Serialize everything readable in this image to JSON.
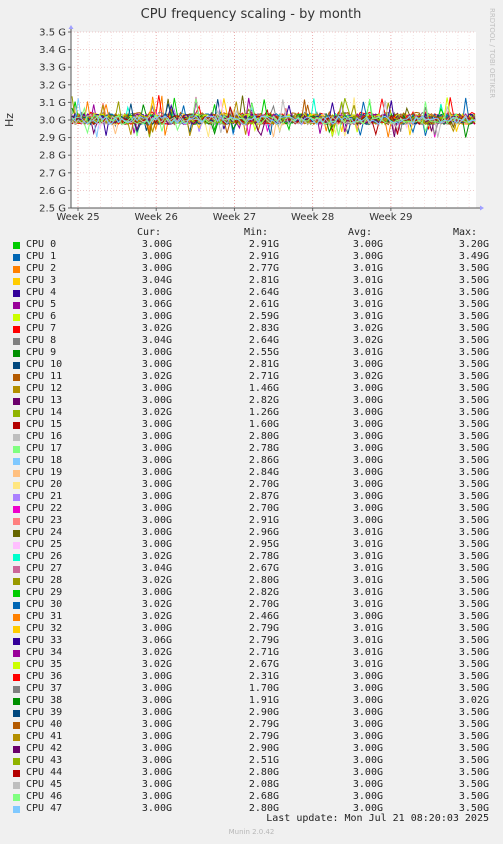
{
  "watermark": "RRDTOOL / TOBI OETIKER",
  "footer": {
    "last_update": "Last update: Mon Jul 21 08:20:03 2025",
    "version": "Munin 2.0.42"
  },
  "legend_headers": {
    "cur": "Cur:",
    "min": "Min:",
    "avg": "Avg:",
    "max": "Max:"
  },
  "chart_data": {
    "type": "line",
    "title": "CPU frequency scaling - by month",
    "ylabel": "Hz",
    "ylim": [
      2.5,
      3.5
    ],
    "yticks": [
      "2.5 G",
      "2.6 G",
      "2.7 G",
      "2.8 G",
      "2.9 G",
      "3.0 G",
      "3.1 G",
      "3.2 G",
      "3.3 G",
      "3.4 G",
      "3.5 G"
    ],
    "xticks": [
      "Week 25",
      "Week 26",
      "Week 27",
      "Week 28",
      "Week 29"
    ],
    "grid": true,
    "series": [
      {
        "name": "CPU 0",
        "color": "#00cc00",
        "cur": "3.00G",
        "min": "2.91G",
        "avg": "3.00G",
        "max": "3.20G"
      },
      {
        "name": "CPU 1",
        "color": "#0066b3",
        "cur": "3.00G",
        "min": "2.91G",
        "avg": "3.00G",
        "max": "3.49G"
      },
      {
        "name": "CPU 2",
        "color": "#ff8000",
        "cur": "3.00G",
        "min": "2.77G",
        "avg": "3.01G",
        "max": "3.50G"
      },
      {
        "name": "CPU 3",
        "color": "#ffcc00",
        "cur": "3.04G",
        "min": "2.81G",
        "avg": "3.01G",
        "max": "3.50G"
      },
      {
        "name": "CPU 4",
        "color": "#330099",
        "cur": "3.00G",
        "min": "2.64G",
        "avg": "3.01G",
        "max": "3.50G"
      },
      {
        "name": "CPU 5",
        "color": "#990099",
        "cur": "3.06G",
        "min": "2.61G",
        "avg": "3.01G",
        "max": "3.50G"
      },
      {
        "name": "CPU 6",
        "color": "#ccff00",
        "cur": "3.00G",
        "min": "2.59G",
        "avg": "3.01G",
        "max": "3.50G"
      },
      {
        "name": "CPU 7",
        "color": "#ff0000",
        "cur": "3.02G",
        "min": "2.83G",
        "avg": "3.02G",
        "max": "3.50G"
      },
      {
        "name": "CPU 8",
        "color": "#808080",
        "cur": "3.04G",
        "min": "2.64G",
        "avg": "3.02G",
        "max": "3.50G"
      },
      {
        "name": "CPU 9",
        "color": "#008f00",
        "cur": "3.00G",
        "min": "2.55G",
        "avg": "3.01G",
        "max": "3.50G"
      },
      {
        "name": "CPU 10",
        "color": "#00487d",
        "cur": "3.00G",
        "min": "2.81G",
        "avg": "3.00G",
        "max": "3.50G"
      },
      {
        "name": "CPU 11",
        "color": "#b35a00",
        "cur": "3.02G",
        "min": "2.71G",
        "avg": "3.02G",
        "max": "3.50G"
      },
      {
        "name": "CPU 12",
        "color": "#b38f00",
        "cur": "3.00G",
        "min": "1.46G",
        "avg": "3.00G",
        "max": "3.50G"
      },
      {
        "name": "CPU 13",
        "color": "#6b006b",
        "cur": "3.00G",
        "min": "2.82G",
        "avg": "3.00G",
        "max": "3.50G"
      },
      {
        "name": "CPU 14",
        "color": "#8fb300",
        "cur": "3.02G",
        "min": "1.26G",
        "avg": "3.00G",
        "max": "3.50G"
      },
      {
        "name": "CPU 15",
        "color": "#b30000",
        "cur": "3.00G",
        "min": "1.60G",
        "avg": "3.00G",
        "max": "3.50G"
      },
      {
        "name": "CPU 16",
        "color": "#bebebe",
        "cur": "3.00G",
        "min": "2.80G",
        "avg": "3.00G",
        "max": "3.50G"
      },
      {
        "name": "CPU 17",
        "color": "#80ff80",
        "cur": "3.00G",
        "min": "2.78G",
        "avg": "3.00G",
        "max": "3.50G"
      },
      {
        "name": "CPU 18",
        "color": "#80c9ff",
        "cur": "3.00G",
        "min": "2.86G",
        "avg": "3.00G",
        "max": "3.50G"
      },
      {
        "name": "CPU 19",
        "color": "#ffc080",
        "cur": "3.00G",
        "min": "2.84G",
        "avg": "3.00G",
        "max": "3.50G"
      },
      {
        "name": "CPU 20",
        "color": "#ffe680",
        "cur": "3.00G",
        "min": "2.70G",
        "avg": "3.00G",
        "max": "3.50G"
      },
      {
        "name": "CPU 21",
        "color": "#aa80ff",
        "cur": "3.00G",
        "min": "2.87G",
        "avg": "3.00G",
        "max": "3.50G"
      },
      {
        "name": "CPU 22",
        "color": "#ee00cc",
        "cur": "3.00G",
        "min": "2.70G",
        "avg": "3.00G",
        "max": "3.50G"
      },
      {
        "name": "CPU 23",
        "color": "#ff8080",
        "cur": "3.00G",
        "min": "2.91G",
        "avg": "3.00G",
        "max": "3.50G"
      },
      {
        "name": "CPU 24",
        "color": "#666600",
        "cur": "3.00G",
        "min": "2.96G",
        "avg": "3.01G",
        "max": "3.50G"
      },
      {
        "name": "CPU 25",
        "color": "#ffbfff",
        "cur": "3.00G",
        "min": "2.95G",
        "avg": "3.01G",
        "max": "3.50G"
      },
      {
        "name": "CPU 26",
        "color": "#00ffcc",
        "cur": "3.02G",
        "min": "2.78G",
        "avg": "3.01G",
        "max": "3.50G"
      },
      {
        "name": "CPU 27",
        "color": "#cc6699",
        "cur": "3.04G",
        "min": "2.67G",
        "avg": "3.01G",
        "max": "3.50G"
      },
      {
        "name": "CPU 28",
        "color": "#999900",
        "cur": "3.02G",
        "min": "2.80G",
        "avg": "3.01G",
        "max": "3.50G"
      },
      {
        "name": "CPU 29",
        "color": "#00cc00",
        "cur": "3.00G",
        "min": "2.82G",
        "avg": "3.01G",
        "max": "3.50G"
      },
      {
        "name": "CPU 30",
        "color": "#0066b3",
        "cur": "3.02G",
        "min": "2.70G",
        "avg": "3.01G",
        "max": "3.50G"
      },
      {
        "name": "CPU 31",
        "color": "#ff8000",
        "cur": "3.02G",
        "min": "2.46G",
        "avg": "3.00G",
        "max": "3.50G"
      },
      {
        "name": "CPU 32",
        "color": "#ffcc00",
        "cur": "3.00G",
        "min": "2.79G",
        "avg": "3.01G",
        "max": "3.50G"
      },
      {
        "name": "CPU 33",
        "color": "#330099",
        "cur": "3.06G",
        "min": "2.79G",
        "avg": "3.01G",
        "max": "3.50G"
      },
      {
        "name": "CPU 34",
        "color": "#990099",
        "cur": "3.02G",
        "min": "2.71G",
        "avg": "3.01G",
        "max": "3.50G"
      },
      {
        "name": "CPU 35",
        "color": "#ccff00",
        "cur": "3.02G",
        "min": "2.67G",
        "avg": "3.01G",
        "max": "3.50G"
      },
      {
        "name": "CPU 36",
        "color": "#ff0000",
        "cur": "3.00G",
        "min": "2.31G",
        "avg": "3.00G",
        "max": "3.50G"
      },
      {
        "name": "CPU 37",
        "color": "#808080",
        "cur": "3.00G",
        "min": "1.70G",
        "avg": "3.00G",
        "max": "3.50G"
      },
      {
        "name": "CPU 38",
        "color": "#008f00",
        "cur": "3.00G",
        "min": "1.91G",
        "avg": "3.00G",
        "max": "3.02G"
      },
      {
        "name": "CPU 39",
        "color": "#00487d",
        "cur": "3.00G",
        "min": "2.90G",
        "avg": "3.00G",
        "max": "3.50G"
      },
      {
        "name": "CPU 40",
        "color": "#b35a00",
        "cur": "3.00G",
        "min": "2.79G",
        "avg": "3.00G",
        "max": "3.50G"
      },
      {
        "name": "CPU 41",
        "color": "#b38f00",
        "cur": "3.00G",
        "min": "2.79G",
        "avg": "3.00G",
        "max": "3.50G"
      },
      {
        "name": "CPU 42",
        "color": "#6b006b",
        "cur": "3.00G",
        "min": "2.90G",
        "avg": "3.00G",
        "max": "3.50G"
      },
      {
        "name": "CPU 43",
        "color": "#8fb300",
        "cur": "3.00G",
        "min": "2.51G",
        "avg": "3.00G",
        "max": "3.50G"
      },
      {
        "name": "CPU 44",
        "color": "#b30000",
        "cur": "3.00G",
        "min": "2.80G",
        "avg": "3.00G",
        "max": "3.50G"
      },
      {
        "name": "CPU 45",
        "color": "#bebebe",
        "cur": "3.00G",
        "min": "2.08G",
        "avg": "3.00G",
        "max": "3.50G"
      },
      {
        "name": "CPU 46",
        "color": "#80ff80",
        "cur": "3.00G",
        "min": "2.68G",
        "avg": "3.00G",
        "max": "3.50G"
      },
      {
        "name": "CPU 47",
        "color": "#80c9ff",
        "cur": "3.00G",
        "min": "2.80G",
        "avg": "3.00G",
        "max": "3.50G"
      }
    ]
  }
}
